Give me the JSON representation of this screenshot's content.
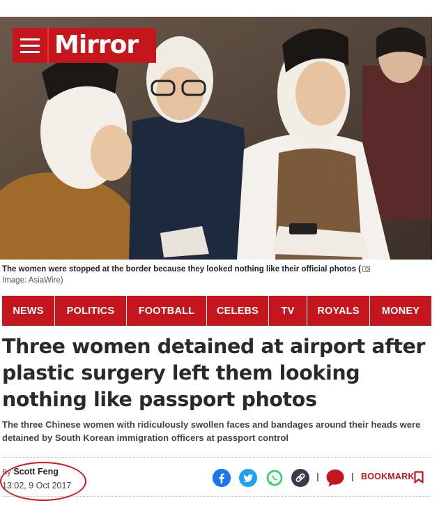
{
  "brand": {
    "logo": "Mirror",
    "color": "#c4161c"
  },
  "photo": {
    "caption": "The women were stopped at the border because they looked nothing like their official photos (",
    "credit": "Image: AsiaWire)"
  },
  "nav": [
    "NEWS",
    "POLITICS",
    "FOOTBALL",
    "CELEBS",
    "TV",
    "ROYALS",
    "MONEY"
  ],
  "article": {
    "headline": "Three women detained at airport after plastic surgery left them looking nothing like passport photos",
    "standfirst": "The three Chinese women with ridiculously swollen faces and bandages around their heads were detained by South Korean immigration officers at passport control",
    "byline_prefix": "By",
    "author": "Scott Feng",
    "date": "13:02, 9 Oct 2017"
  },
  "share": {
    "icons": [
      "facebook-icon",
      "twitter-icon",
      "whatsapp-icon",
      "link-icon",
      "comment-icon"
    ],
    "bookmark_label": "BOOKMARK"
  }
}
